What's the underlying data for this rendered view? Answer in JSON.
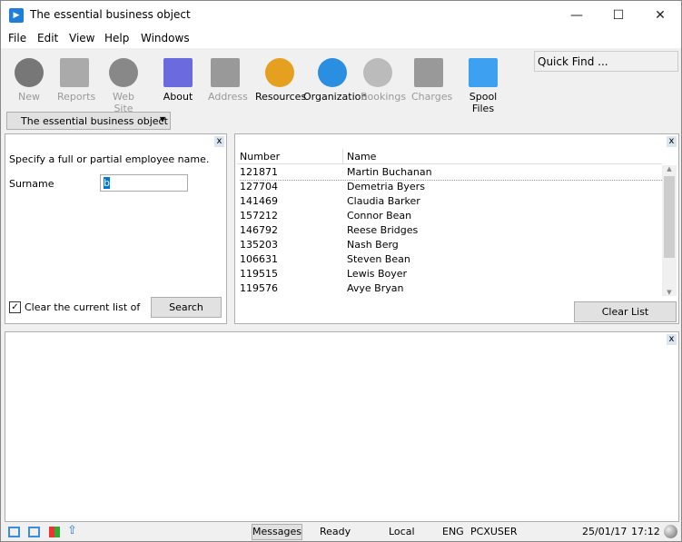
{
  "window": {
    "title": "The essential business object",
    "minimize": "—",
    "maximize": "☐",
    "close": "✕"
  },
  "menu": [
    "File",
    "Edit",
    "View",
    "Help",
    "Windows"
  ],
  "toolbar": [
    {
      "label": "New",
      "enabled": false,
      "icon": "plus-circle-icon",
      "color": "#777"
    },
    {
      "label": "Reports",
      "enabled": false,
      "icon": "folder-icon",
      "color": "#aaa"
    },
    {
      "label": "Web Site",
      "enabled": false,
      "icon": "globe-icon",
      "color": "#888"
    },
    {
      "label": "About",
      "enabled": true,
      "icon": "about-gear-icon",
      "color": "#6b6bdf"
    },
    {
      "label": "Address",
      "enabled": false,
      "icon": "envelope-icon",
      "color": "#999"
    },
    {
      "label": "Resources",
      "enabled": true,
      "icon": "person-headset-icon",
      "color": "#e6a020"
    },
    {
      "label": "Organization",
      "enabled": true,
      "icon": "gear-icon",
      "color": "#2a8fe0"
    },
    {
      "label": "Bookings",
      "enabled": false,
      "icon": "clock-icon",
      "color": "#bbb"
    },
    {
      "label": "Charges",
      "enabled": false,
      "icon": "database-icon",
      "color": "#999"
    },
    {
      "label": "Spool Files",
      "enabled": true,
      "icon": "document-icon",
      "color": "#3ea0f0"
    }
  ],
  "quick_find": "Quick Find ...",
  "context_dropdown": "The essential business object",
  "search_panel": {
    "instruction": "Specify a full or partial employee name.",
    "surname_label": "Surname",
    "surname_value": "b",
    "clear_checkbox_label": "Clear the current list of emp",
    "clear_checked": true,
    "search_button": "Search",
    "close": "x"
  },
  "results": {
    "close": "x",
    "columns": [
      "Number",
      "Name"
    ],
    "rows": [
      [
        "121871",
        "Martin Buchanan"
      ],
      [
        "127704",
        "Demetria Byers"
      ],
      [
        "141469",
        "Claudia Barker"
      ],
      [
        "157212",
        "Connor Bean"
      ],
      [
        "146792",
        "Reese Bridges"
      ],
      [
        "135203",
        "Nash Berg"
      ],
      [
        "106631",
        "Steven Bean"
      ],
      [
        "119515",
        "Lewis Boyer"
      ],
      [
        "119576",
        "Avye Bryan"
      ]
    ],
    "clear_button": "Clear List"
  },
  "bottom_panel": {
    "close": "x"
  },
  "status": {
    "messages": "Messages",
    "state": "Ready",
    "location": "Local",
    "language": "ENG",
    "user": "PCXUSER",
    "date": "25/01/17",
    "time": "17:12"
  }
}
